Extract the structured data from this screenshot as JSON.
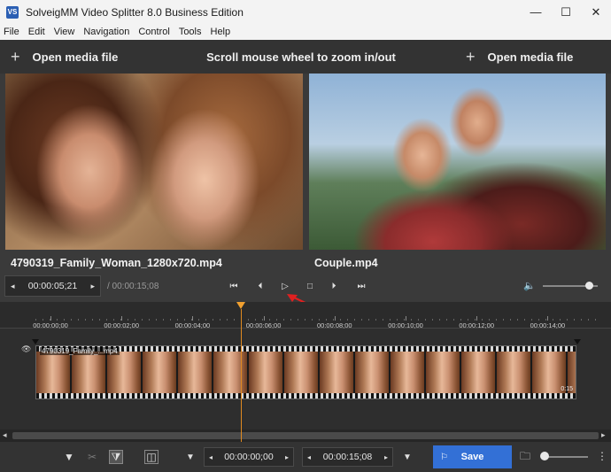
{
  "window": {
    "app_icon_text": "VS",
    "title": "SolveigMM Video Splitter 8.0 Business Edition",
    "minimize": "—",
    "maximize": "☐",
    "close": "✕"
  },
  "menu": [
    "File",
    "Edit",
    "View",
    "Navigation",
    "Control",
    "Tools",
    "Help"
  ],
  "media_bar": {
    "plus": "+",
    "open_left_label": "Open media file",
    "zoom_hint": "Scroll mouse wheel to zoom in/out",
    "open_right_label": "Open media file"
  },
  "previews": {
    "left_filename": "4790319_Family_Woman_1280x720.mp4",
    "right_filename": "Couple.mp4"
  },
  "transport": {
    "prev_arrow": "◂",
    "current_time": "00:00:05;21",
    "next_arrow": "▸",
    "total_time": "/ 00:00:15;08",
    "btn_go_start": "⏮",
    "btn_prev_frame": "⏴",
    "btn_play": "▷",
    "btn_stop": "□",
    "btn_next_frame": "⏵",
    "btn_go_end": "⏭",
    "volume_icon": "🔈",
    "volume_level": 0.85
  },
  "timeline": {
    "ticks": [
      "00:00:00;00",
      "00:00:02;00",
      "00:00:04;00",
      "00:00:06;00",
      "00:00:08;00",
      "00:00:10;00",
      "00:00:12;00",
      "00:00:14;00"
    ],
    "playhead_time": "00:00:05;21",
    "eye_icon": "👁",
    "clip_label": "4790319_Family_...mp4",
    "clip_end_label": "0:15"
  },
  "scrollbar": {
    "left_arrow": "◂",
    "right_arrow": "▸"
  },
  "bottom": {
    "marker_icon": "▼",
    "cut_icon": "✂",
    "split_icon": "⧩",
    "trim_icon": "◫",
    "start_marker_icon": "▼",
    "start_prev": "◂",
    "start_time": "00:00:00;00",
    "start_next": "▸",
    "end_prev": "◂",
    "end_time": "00:00:15;08",
    "end_next": "▸",
    "end_marker_icon": "▼",
    "save_icon": "⚐",
    "save_label": "Save",
    "folder_icon": "🗀",
    "more_icon": "⋮",
    "zoom_level": 0.0
  },
  "colors": {
    "accent": "#3370d6",
    "playhead": "#f0a030",
    "annotation_arrow": "#e02020"
  }
}
